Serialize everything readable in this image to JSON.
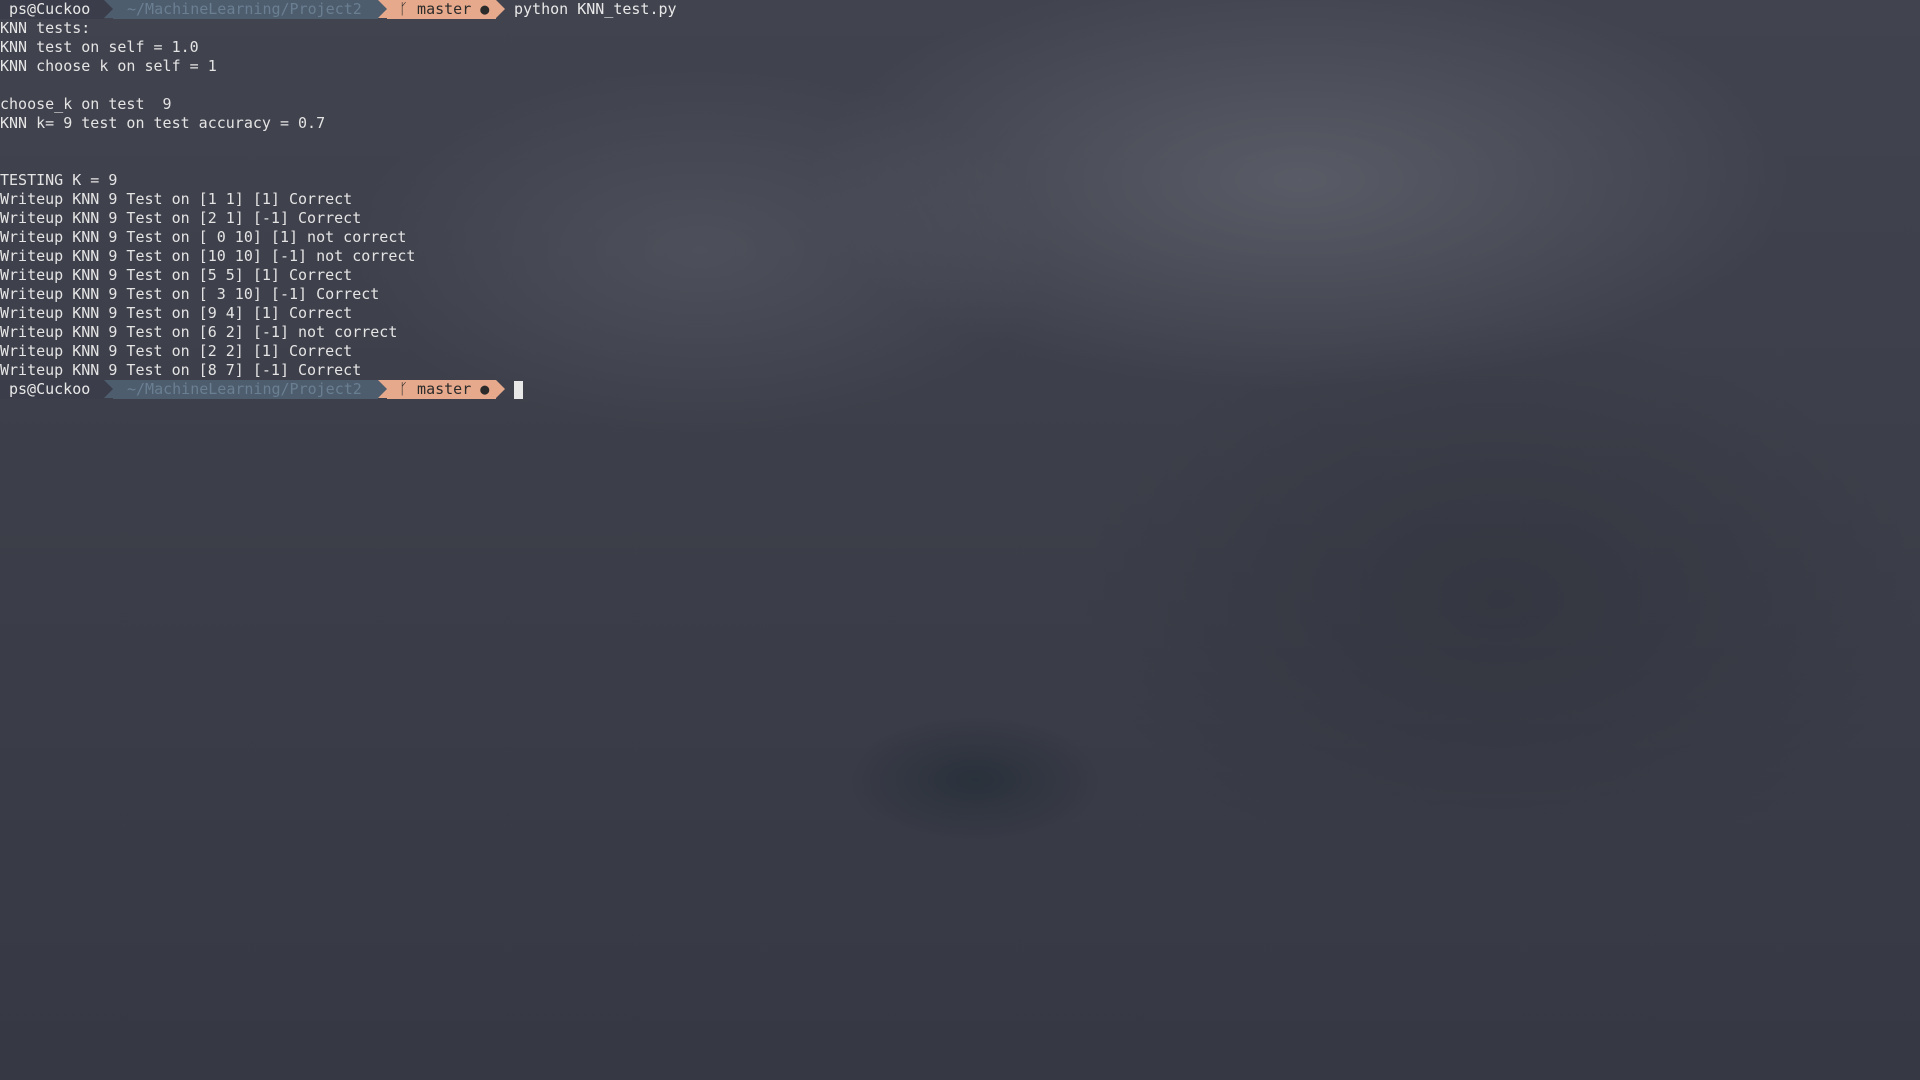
{
  "prompt": {
    "user_host": "ps@Cuckoo",
    "path": "~/MachineLearning/Project2",
    "branch_icon": "git-branch-icon",
    "branch_glyph": "ᚴ",
    "branch": "master",
    "dirty_indicator": "●",
    "command": "python KNN_test.py"
  },
  "colors": {
    "user_bg": "#3b3e4a",
    "path_bg": "#4d5d6e",
    "git_bg": "#e6a98b",
    "text": "#e4e4e4"
  },
  "output": [
    "KNN tests:",
    "KNN test on self = 1.0",
    "KNN choose k on self = 1",
    "",
    "choose_k on test  9",
    "KNN k= 9 test on test accuracy = 0.7",
    "",
    "",
    "TESTING K = 9",
    "Writeup KNN 9 Test on [1 1] [1] Correct",
    "Writeup KNN 9 Test on [2 1] [-1] Correct",
    "Writeup KNN 9 Test on [ 0 10] [1] not correct",
    "Writeup KNN 9 Test on [10 10] [-1] not correct",
    "Writeup KNN 9 Test on [5 5] [1] Correct",
    "Writeup KNN 9 Test on [ 3 10] [-1] Correct",
    "Writeup KNN 9 Test on [9 4] [1] Correct",
    "Writeup KNN 9 Test on [6 2] [-1] not correct",
    "Writeup KNN 9 Test on [2 2] [1] Correct",
    "Writeup KNN 9 Test on [8 7] [-1] Correct"
  ]
}
